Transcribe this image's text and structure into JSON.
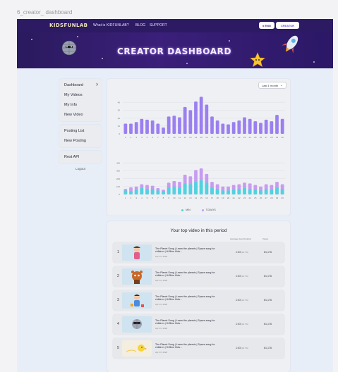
{
  "frame_title": "6_creator_ dashboard",
  "navbar": {
    "logo": "KIDSFUNLAB",
    "links": [
      "What is KIDFUNLAB?",
      "BLOG",
      "SUPPORT"
    ],
    "lang_label": "ENG",
    "creator_label": "CREATOR"
  },
  "banner": {
    "title": "CREATOR DASHBOARD"
  },
  "sidebar": {
    "group1": [
      "Dashboard",
      "My Videos",
      "My Info",
      "New Video"
    ],
    "group2": [
      "Posting List",
      "New Posting"
    ],
    "group3": [
      "Rest API"
    ],
    "logout": "Logout"
  },
  "period": {
    "selected": "Last 1 month"
  },
  "chart_data": [
    {
      "type": "bar",
      "title": "",
      "categories": [
        "1",
        "2",
        "3",
        "4",
        "5",
        "6",
        "7",
        "8",
        "9",
        "10",
        "11",
        "12",
        "13",
        "14",
        "15",
        "16",
        "17",
        "18",
        "19",
        "20",
        "21",
        "22",
        "23",
        "24",
        "25",
        "26",
        "27",
        "28",
        "29",
        "30"
      ],
      "values": [
        13,
        13,
        15,
        19,
        18,
        17,
        13,
        8,
        22,
        23,
        21,
        34,
        30,
        41,
        47,
        37,
        22,
        17,
        13,
        12,
        15,
        17,
        21,
        19,
        16,
        14,
        18,
        16,
        24,
        19
      ],
      "y_tick_labels": [
        "40",
        "30",
        "20",
        "10",
        "0"
      ],
      "ylim": [
        0,
        50
      ],
      "colors": {
        "bar": "#9b7ff0"
      }
    },
    {
      "type": "bar",
      "title": "",
      "stacked": true,
      "categories": [
        "1",
        "2",
        "3",
        "4",
        "5",
        "6",
        "7",
        "8",
        "9",
        "10",
        "11",
        "12",
        "13",
        "14",
        "15",
        "16",
        "17",
        "18",
        "19",
        "20",
        "21",
        "22",
        "23",
        "24",
        "25",
        "26",
        "27",
        "28",
        "29",
        "30"
      ],
      "series": [
        {
          "name": "MIN",
          "values": [
            50,
            40,
            60,
            80,
            70,
            70,
            50,
            40,
            90,
            100,
            90,
            140,
            130,
            160,
            180,
            150,
            90,
            70,
            50,
            50,
            60,
            70,
            80,
            70,
            60,
            50,
            70,
            60,
            90,
            70
          ],
          "color": "#4fd3e0"
        },
        {
          "name": "TODAYS",
          "values": [
            70,
            90,
            100,
            130,
            120,
            110,
            80,
            60,
            150,
            170,
            160,
            250,
            230,
            310,
            330,
            260,
            160,
            130,
            100,
            100,
            120,
            130,
            150,
            140,
            120,
            100,
            130,
            120,
            160,
            130
          ],
          "color": "#c89bf0"
        }
      ],
      "y_tick_labels": [
        "400",
        "300",
        "200",
        "100",
        "0"
      ],
      "ylim": [
        0,
        500
      ],
      "grid": true,
      "legend": "bottom"
    }
  ],
  "videos": {
    "title": "Your top video in this period",
    "col_avg": "Average view Duration",
    "col_views": "Views",
    "rows": [
      {
        "rank": "1",
        "title": "The Planet Song | Learn the planets | Space song for children | Hi Bine Kids...",
        "date": "Apr 13, 2020",
        "avg": "1:03",
        "avg_pct": "(44.7%)",
        "views": "61,176",
        "thumb": "girl"
      },
      {
        "rank": "2",
        "title": "The Planet Song | Learn the planets | Space song for children | Hi Bine Kids...",
        "date": "Apr 13, 2020",
        "avg": "1:03",
        "avg_pct": "(44.7%)",
        "views": "61,176",
        "thumb": "bear"
      },
      {
        "rank": "3",
        "title": "The Planet Song | Learn the planets | Space song for children | Hi Bine Kids...",
        "date": "Apr 13, 2020",
        "avg": "1:03",
        "avg_pct": "(44.7%)",
        "views": "61,176",
        "thumb": "kid"
      },
      {
        "rank": "4",
        "title": "The Planet Song | Learn the planets | Space song for children | Hi Bine Kids...",
        "date": "Apr 13, 2020",
        "avg": "1:03",
        "avg_pct": "(44.7%)",
        "views": "61,176",
        "thumb": "ball"
      },
      {
        "rank": "5",
        "title": "The Planet Song | Learn the planets | Space song for children | Hi Bine Kids...",
        "date": "Apr 13, 2020",
        "avg": "1:03",
        "avg_pct": "(44.7%)",
        "views": "61,176",
        "thumb": "chick"
      }
    ]
  }
}
